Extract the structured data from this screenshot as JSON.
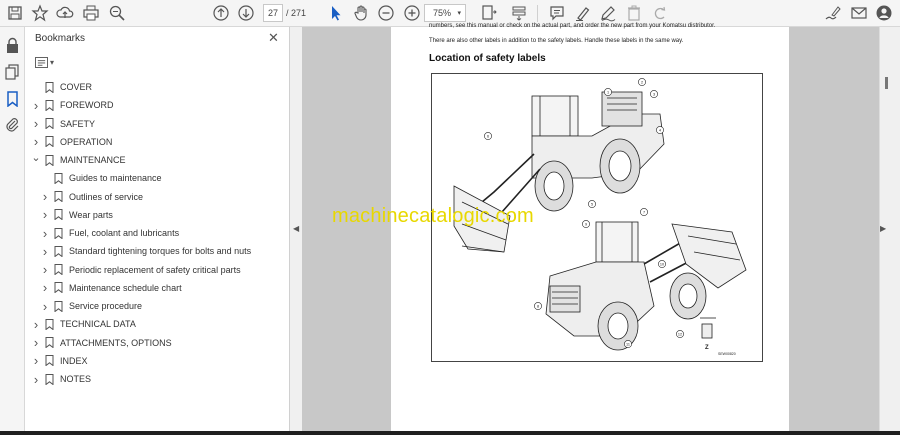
{
  "toolbar": {
    "page_current": "27",
    "page_total": "/  271",
    "zoom": "75%"
  },
  "bookmarks_panel": {
    "title": "Bookmarks",
    "items": [
      {
        "label": "COVER",
        "expandable": false,
        "expanded": false
      },
      {
        "label": "FOREWORD",
        "expandable": true,
        "expanded": false
      },
      {
        "label": "SAFETY",
        "expandable": true,
        "expanded": false
      },
      {
        "label": "OPERATION",
        "expandable": true,
        "expanded": false
      },
      {
        "label": "MAINTENANCE",
        "expandable": true,
        "expanded": true
      },
      {
        "label": "Guides to maintenance",
        "expandable": false,
        "expanded": false
      },
      {
        "label": "Outlines of service",
        "expandable": true,
        "expanded": false
      },
      {
        "label": "Wear parts",
        "expandable": true,
        "expanded": false
      },
      {
        "label": "Fuel, coolant and lubricants",
        "expandable": true,
        "expanded": false
      },
      {
        "label": "Standard tightening torques for bolts and nuts",
        "expandable": true,
        "expanded": false
      },
      {
        "label": "Periodic replacement of safety critical parts",
        "expandable": true,
        "expanded": false
      },
      {
        "label": "Maintenance schedule chart",
        "expandable": true,
        "expanded": false
      },
      {
        "label": "Service procedure",
        "expandable": true,
        "expanded": false
      },
      {
        "label": "TECHNICAL DATA",
        "expandable": true,
        "expanded": false
      },
      {
        "label": "ATTACHMENTS, OPTIONS",
        "expandable": true,
        "expanded": false
      },
      {
        "label": "INDEX",
        "expandable": true,
        "expanded": false
      },
      {
        "label": "NOTES",
        "expandable": true,
        "expanded": false
      }
    ]
  },
  "document": {
    "line1": "numbers, see this manual or check on the actual part, and order the new part from your Komatsu distributor.",
    "line2": "There are also other labels in addition to the safety labels.  Handle these labels in the same way.",
    "heading": "Location of safety labels",
    "figure_code": "SEW00820",
    "figure_z_label": "Z",
    "callouts": [
      "1",
      "2",
      "3",
      "4",
      "5",
      "6",
      "7",
      "8",
      "9",
      "10",
      "11",
      "12"
    ]
  },
  "watermark": "machinecatalogic.com"
}
